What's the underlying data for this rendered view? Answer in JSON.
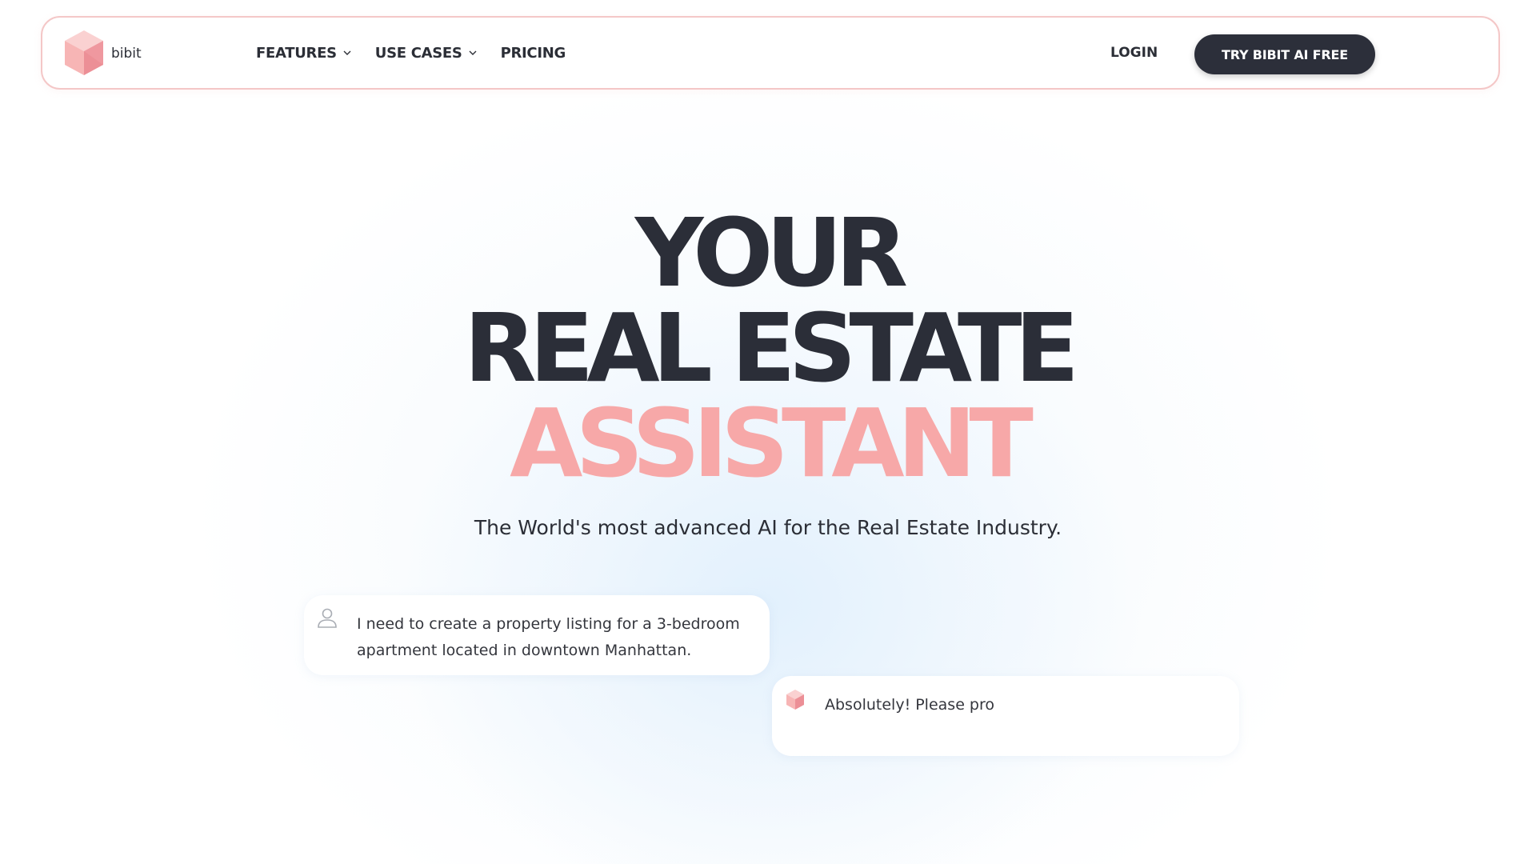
{
  "brand": {
    "name": "bibit",
    "accent_color": "#f7a8a8",
    "dark_color": "#2c2f3a"
  },
  "nav": {
    "items": [
      {
        "label": "FEATURES",
        "has_dropdown": true
      },
      {
        "label": "USE CASES",
        "has_dropdown": true
      },
      {
        "label": "PRICING",
        "has_dropdown": false
      }
    ],
    "login_label": "LOGIN",
    "cta_label": "TRY BIBIT AI FREE"
  },
  "hero": {
    "line1": "YOUR",
    "line2": "REAL ESTATE",
    "line3": "ASSISTANT",
    "subtitle": "The World's most advanced AI for the Real Estate Industry."
  },
  "chat": {
    "user_message": "I need to create a property listing for a 3-bedroom apartment located in downtown Manhattan.",
    "user_icon": "user-icon",
    "ai_message": "Absolutely! Please pro",
    "ai_icon": "bibit-cube-icon"
  }
}
